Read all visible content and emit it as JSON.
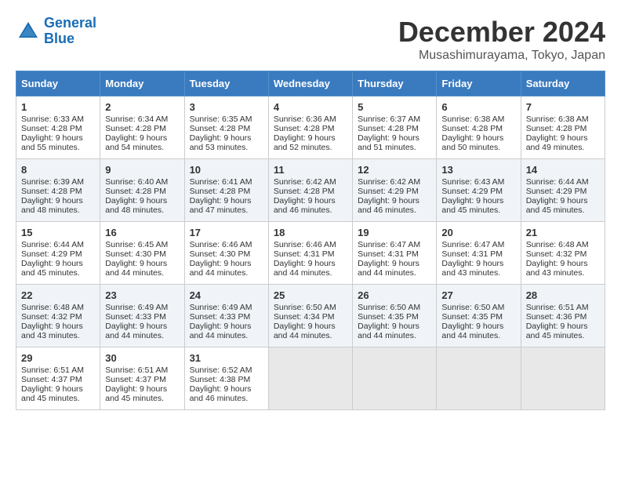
{
  "header": {
    "logo_line1": "General",
    "logo_line2": "Blue",
    "month": "December 2024",
    "location": "Musashimurayama, Tokyo, Japan"
  },
  "days_of_week": [
    "Sunday",
    "Monday",
    "Tuesday",
    "Wednesday",
    "Thursday",
    "Friday",
    "Saturday"
  ],
  "weeks": [
    [
      {
        "day": "1",
        "sunrise": "Sunrise: 6:33 AM",
        "sunset": "Sunset: 4:28 PM",
        "daylight": "Daylight: 9 hours and 55 minutes."
      },
      {
        "day": "2",
        "sunrise": "Sunrise: 6:34 AM",
        "sunset": "Sunset: 4:28 PM",
        "daylight": "Daylight: 9 hours and 54 minutes."
      },
      {
        "day": "3",
        "sunrise": "Sunrise: 6:35 AM",
        "sunset": "Sunset: 4:28 PM",
        "daylight": "Daylight: 9 hours and 53 minutes."
      },
      {
        "day": "4",
        "sunrise": "Sunrise: 6:36 AM",
        "sunset": "Sunset: 4:28 PM",
        "daylight": "Daylight: 9 hours and 52 minutes."
      },
      {
        "day": "5",
        "sunrise": "Sunrise: 6:37 AM",
        "sunset": "Sunset: 4:28 PM",
        "daylight": "Daylight: 9 hours and 51 minutes."
      },
      {
        "day": "6",
        "sunrise": "Sunrise: 6:38 AM",
        "sunset": "Sunset: 4:28 PM",
        "daylight": "Daylight: 9 hours and 50 minutes."
      },
      {
        "day": "7",
        "sunrise": "Sunrise: 6:38 AM",
        "sunset": "Sunset: 4:28 PM",
        "daylight": "Daylight: 9 hours and 49 minutes."
      }
    ],
    [
      {
        "day": "8",
        "sunrise": "Sunrise: 6:39 AM",
        "sunset": "Sunset: 4:28 PM",
        "daylight": "Daylight: 9 hours and 48 minutes."
      },
      {
        "day": "9",
        "sunrise": "Sunrise: 6:40 AM",
        "sunset": "Sunset: 4:28 PM",
        "daylight": "Daylight: 9 hours and 48 minutes."
      },
      {
        "day": "10",
        "sunrise": "Sunrise: 6:41 AM",
        "sunset": "Sunset: 4:28 PM",
        "daylight": "Daylight: 9 hours and 47 minutes."
      },
      {
        "day": "11",
        "sunrise": "Sunrise: 6:42 AM",
        "sunset": "Sunset: 4:28 PM",
        "daylight": "Daylight: 9 hours and 46 minutes."
      },
      {
        "day": "12",
        "sunrise": "Sunrise: 6:42 AM",
        "sunset": "Sunset: 4:29 PM",
        "daylight": "Daylight: 9 hours and 46 minutes."
      },
      {
        "day": "13",
        "sunrise": "Sunrise: 6:43 AM",
        "sunset": "Sunset: 4:29 PM",
        "daylight": "Daylight: 9 hours and 45 minutes."
      },
      {
        "day": "14",
        "sunrise": "Sunrise: 6:44 AM",
        "sunset": "Sunset: 4:29 PM",
        "daylight": "Daylight: 9 hours and 45 minutes."
      }
    ],
    [
      {
        "day": "15",
        "sunrise": "Sunrise: 6:44 AM",
        "sunset": "Sunset: 4:29 PM",
        "daylight": "Daylight: 9 hours and 45 minutes."
      },
      {
        "day": "16",
        "sunrise": "Sunrise: 6:45 AM",
        "sunset": "Sunset: 4:30 PM",
        "daylight": "Daylight: 9 hours and 44 minutes."
      },
      {
        "day": "17",
        "sunrise": "Sunrise: 6:46 AM",
        "sunset": "Sunset: 4:30 PM",
        "daylight": "Daylight: 9 hours and 44 minutes."
      },
      {
        "day": "18",
        "sunrise": "Sunrise: 6:46 AM",
        "sunset": "Sunset: 4:31 PM",
        "daylight": "Daylight: 9 hours and 44 minutes."
      },
      {
        "day": "19",
        "sunrise": "Sunrise: 6:47 AM",
        "sunset": "Sunset: 4:31 PM",
        "daylight": "Daylight: 9 hours and 44 minutes."
      },
      {
        "day": "20",
        "sunrise": "Sunrise: 6:47 AM",
        "sunset": "Sunset: 4:31 PM",
        "daylight": "Daylight: 9 hours and 43 minutes."
      },
      {
        "day": "21",
        "sunrise": "Sunrise: 6:48 AM",
        "sunset": "Sunset: 4:32 PM",
        "daylight": "Daylight: 9 hours and 43 minutes."
      }
    ],
    [
      {
        "day": "22",
        "sunrise": "Sunrise: 6:48 AM",
        "sunset": "Sunset: 4:32 PM",
        "daylight": "Daylight: 9 hours and 43 minutes."
      },
      {
        "day": "23",
        "sunrise": "Sunrise: 6:49 AM",
        "sunset": "Sunset: 4:33 PM",
        "daylight": "Daylight: 9 hours and 44 minutes."
      },
      {
        "day": "24",
        "sunrise": "Sunrise: 6:49 AM",
        "sunset": "Sunset: 4:33 PM",
        "daylight": "Daylight: 9 hours and 44 minutes."
      },
      {
        "day": "25",
        "sunrise": "Sunrise: 6:50 AM",
        "sunset": "Sunset: 4:34 PM",
        "daylight": "Daylight: 9 hours and 44 minutes."
      },
      {
        "day": "26",
        "sunrise": "Sunrise: 6:50 AM",
        "sunset": "Sunset: 4:35 PM",
        "daylight": "Daylight: 9 hours and 44 minutes."
      },
      {
        "day": "27",
        "sunrise": "Sunrise: 6:50 AM",
        "sunset": "Sunset: 4:35 PM",
        "daylight": "Daylight: 9 hours and 44 minutes."
      },
      {
        "day": "28",
        "sunrise": "Sunrise: 6:51 AM",
        "sunset": "Sunset: 4:36 PM",
        "daylight": "Daylight: 9 hours and 45 minutes."
      }
    ],
    [
      {
        "day": "29",
        "sunrise": "Sunrise: 6:51 AM",
        "sunset": "Sunset: 4:37 PM",
        "daylight": "Daylight: 9 hours and 45 minutes."
      },
      {
        "day": "30",
        "sunrise": "Sunrise: 6:51 AM",
        "sunset": "Sunset: 4:37 PM",
        "daylight": "Daylight: 9 hours and 45 minutes."
      },
      {
        "day": "31",
        "sunrise": "Sunrise: 6:52 AM",
        "sunset": "Sunset: 4:38 PM",
        "daylight": "Daylight: 9 hours and 46 minutes."
      },
      null,
      null,
      null,
      null
    ]
  ]
}
